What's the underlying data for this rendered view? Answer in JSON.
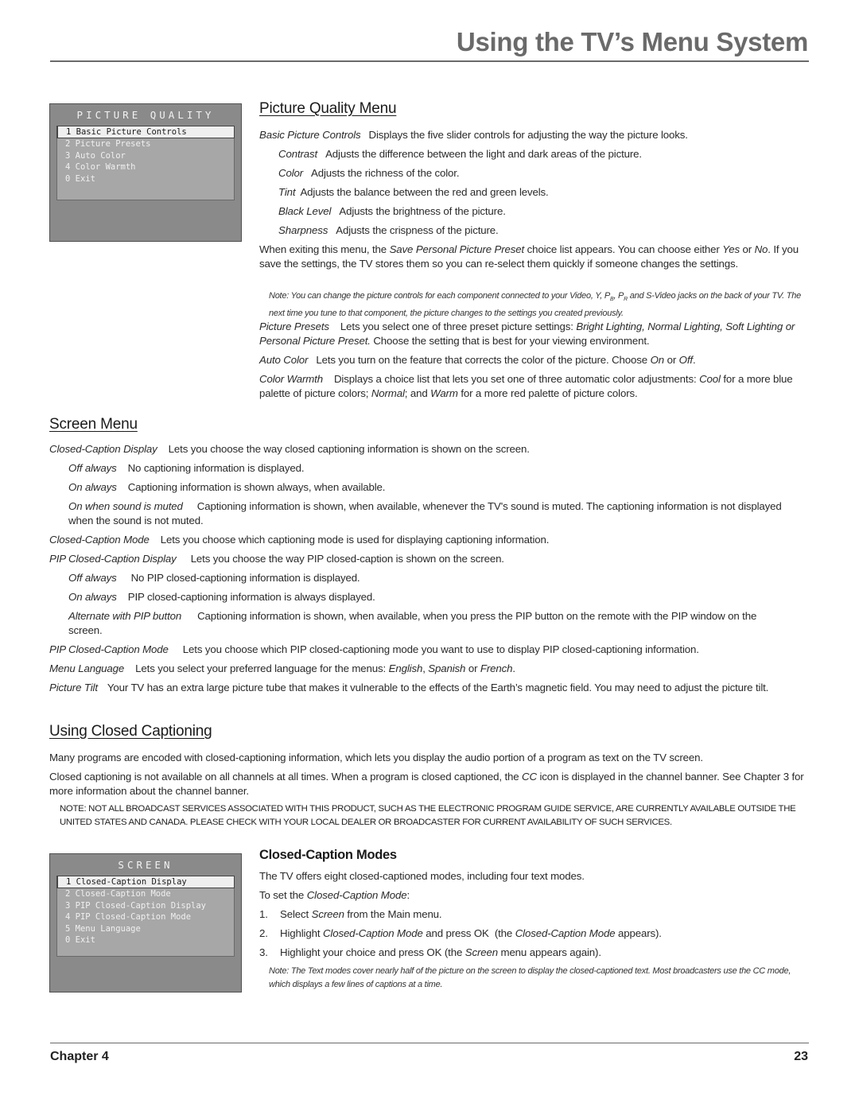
{
  "header": {
    "title": "Using the TV’s Menu System"
  },
  "picture_quality_osd": {
    "title": "PICTURE QUALITY",
    "items": [
      "1 Basic Picture Controls",
      "2 Picture Presets",
      "3 Auto Color",
      "4 Color Warmth",
      "0 Exit"
    ],
    "selected_index": 0
  },
  "picture_quality_menu": {
    "heading": "Picture Quality Menu",
    "basic": {
      "term": "Basic Picture Controls",
      "text": "Displays the five slider controls for adjusting the way the picture looks."
    },
    "controls": [
      {
        "term": "Contrast",
        "text": "Adjusts the difference between the light and dark areas of the picture."
      },
      {
        "term": "Color",
        "text": "Adjusts the richness of the color."
      },
      {
        "term": "Tint",
        "text": "Adjusts the balance between the red and green levels."
      },
      {
        "term": "Black Level",
        "text": "Adjusts the brightness of the picture."
      },
      {
        "term": "Sharpness",
        "text": "Adjusts the crispness of the picture."
      }
    ],
    "exit_text": {
      "a": "When exiting this menu, the ",
      "b": "Save Personal Picture Preset",
      "c": " choice list appears. You can choose either ",
      "d": "Yes",
      "e": " or ",
      "f": "No",
      "g": ". If you save the settings, the TV stores them so you can re-select them quickly if someone changes the settings."
    },
    "note": {
      "a": "Note: You can change the picture controls for each component connected to your Video, Y, P",
      "sub_b": "B",
      "b": ", P",
      "sub_r": "R",
      "c": " and S-Video jacks on the back of your TV. The next time you tune to that component, the picture changes to the settings you created previously."
    },
    "presets": {
      "term": "Picture Presets",
      "a": "Lets you select one of three preset picture settings: ",
      "b": "Bright Lighting, Normal Lighting, Soft Lighting or Personal Picture Preset.",
      "c": " Choose the setting that is best for your viewing environment."
    },
    "auto_color": {
      "term": "Auto Color",
      "a": "Lets you turn on the feature that corrects the color of the picture. Choose ",
      "b": "On",
      "c": " or ",
      "d": "Off",
      "e": "."
    },
    "color_warmth": {
      "term": "Color Warmth",
      "a": "Displays a choice list that lets you set one of three automatic color adjustments: ",
      "b": "Cool",
      "c": " for a more blue palette of picture colors; ",
      "d": "Normal",
      "e": "; and ",
      "f": "Warm",
      "g": " for a more red palette of picture colors."
    }
  },
  "screen_menu": {
    "heading": "Screen Menu",
    "cc_display": {
      "term": "Closed-Caption Display",
      "text": "Lets you choose the way closed captioning information is shown on the screen."
    },
    "cc_options": [
      {
        "term": "Off always",
        "text": "No captioning information is displayed."
      },
      {
        "term": "On always",
        "text": "Captioning information is shown always, when available."
      },
      {
        "term": "On when sound is muted",
        "text": "Captioning information is shown, when available, whenever the TV's sound is muted. The captioning information is not displayed when the sound is not muted."
      }
    ],
    "cc_mode": {
      "term": "Closed-Caption Mode",
      "text": "Lets you choose which captioning mode is used for displaying captioning information."
    },
    "pip_display": {
      "term": "PIP Closed-Caption Display",
      "text": "Lets you choose the way PIP closed-caption is shown on the screen."
    },
    "pip_options": [
      {
        "term": "Off always",
        "text": "No PIP closed-captioning information is displayed."
      },
      {
        "term": "On always",
        "text": "PIP closed-captioning information is always displayed."
      },
      {
        "term": "Alternate with PIP button",
        "text": "Captioning information is shown, when available, when you press the PIP button on the remote with the PIP window on the screen."
      }
    ],
    "pip_mode": {
      "term": "PIP Closed-Caption Mode",
      "text": "Lets you choose which PIP closed-captioning mode you want to use to display PIP closed-captioning information."
    },
    "menu_language": {
      "term": "Menu Language",
      "a": "Lets you select your preferred language for the menus: ",
      "b": "English",
      "c": ", ",
      "d": "Spanish",
      "e": " or ",
      "f": "French",
      "g": "."
    },
    "picture_tilt": {
      "term": "Picture Tilt",
      "text": "Your TV has an extra large picture tube that makes it vulnerable to the effects of the Earth’s magnetic field. You may need to adjust the picture tilt."
    }
  },
  "closed_captioning": {
    "heading": "Using Closed Captioning",
    "p1": "Many programs are encoded with closed-captioning information, which lets you display the audio portion of a program as text on the TV screen.",
    "p2": {
      "a": "Closed captioning is not available on all channels at all times. When a program is closed captioned, the ",
      "b": "CC",
      "c": " icon is displayed in the channel banner. See Chapter 3 for more information about the channel banner."
    },
    "notice": "NOTE: NOT ALL BROADCAST SERVICES ASSOCIATED WITH THIS PRODUCT, SUCH AS THE ELECTRONIC PROGRAM GUIDE SERVICE, ARE CURRENTLY AVAILABLE OUTSIDE THE UNITED STATES AND CANADA. PLEASE CHECK WITH YOUR LOCAL DEALER OR BROADCASTER FOR CURRENT AVAILABILITY OF SUCH SERVICES."
  },
  "screen_osd": {
    "title": "SCREEN",
    "items": [
      "1 Closed-Caption Display",
      "2 Closed-Caption Mode",
      "3 PIP Closed-Caption Display",
      "4 PIP Closed-Caption Mode",
      "5 Menu Language",
      "0 Exit"
    ],
    "selected_index": 0
  },
  "cc_modes": {
    "heading": "Closed-Caption Modes",
    "intro": "The TV offers eight closed-captioned modes, including four text modes.",
    "to_set": {
      "a": "To set the ",
      "b": "Closed-Caption Mode",
      "c": ":"
    },
    "steps": [
      {
        "num": "1.",
        "a": "Select ",
        "b": "Screen",
        "c": " from the Main menu.",
        "d": "",
        "e": ""
      },
      {
        "num": "2.",
        "a": "Highlight ",
        "b": "Closed-Caption Mode",
        "c": " and press OK  (the ",
        "d": "Closed-Caption Mode",
        "e": " appears)."
      },
      {
        "num": "3.",
        "a": "Highlight your choice and press OK (the ",
        "b": "Screen",
        "c": " menu appears again).",
        "d": "",
        "e": ""
      }
    ],
    "note": "Note: The Text modes cover nearly half of the picture on the screen to display the closed-captioned text. Most broadcasters use the CC mode, which displays a few lines of captions at a time."
  },
  "footer": {
    "chapter": "Chapter 4",
    "page": "23"
  }
}
